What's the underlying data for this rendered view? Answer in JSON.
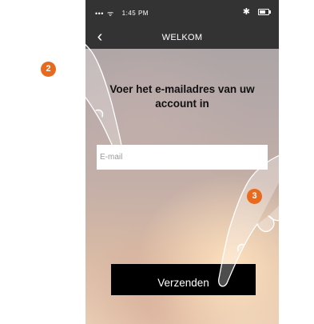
{
  "status_bar": {
    "signal": "•••",
    "wifi": "ᯤ",
    "time": "1:45 PM",
    "bluetooth": "✱"
  },
  "nav": {
    "back_icon": "‹",
    "title": "WELKOM"
  },
  "main": {
    "heading": "Voer het e-mailadres van uw account in",
    "email_placeholder": "E-mail",
    "send_label": "Verzenden"
  },
  "annotations": {
    "step_1": "2",
    "step_2": "3",
    "badge_color": "#e86a1f"
  }
}
